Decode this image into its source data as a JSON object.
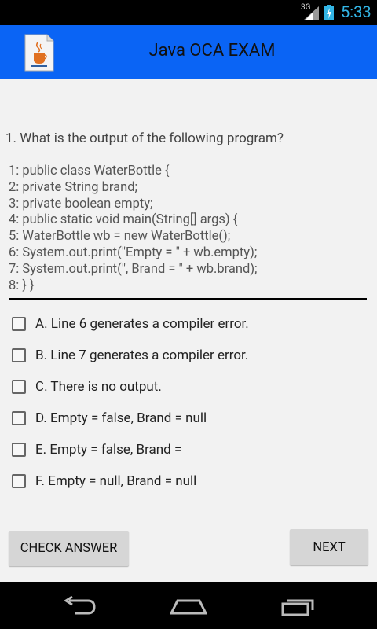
{
  "status_bar": {
    "network": "3G",
    "time": "5:33"
  },
  "app": {
    "title": "Java OCA EXAM"
  },
  "question": {
    "text": "1. What is the output of the following program?",
    "code_lines": [
      "1: public class WaterBottle {",
      "2: private String brand;",
      "3: private boolean empty;",
      "4: public static void main(String[] args) {",
      "5: WaterBottle wb = new WaterBottle();",
      "6: System.out.print(\"Empty = \" + wb.empty);",
      "7: System.out.print(\", Brand = \" + wb.brand);",
      "8: } }"
    ]
  },
  "options": [
    {
      "label": "A. Line 6 generates a compiler error.",
      "checked": false
    },
    {
      "label": "B. Line 7 generates a compiler error.",
      "checked": false
    },
    {
      "label": "C. There is no output.",
      "checked": false
    },
    {
      "label": "D. Empty = false, Brand = null",
      "checked": false
    },
    {
      "label": "E. Empty = false, Brand =",
      "checked": false
    },
    {
      "label": "F. Empty = null, Brand = null",
      "checked": false
    }
  ],
  "buttons": {
    "check_answer": "CHECK ANSWER",
    "next": "NEXT"
  },
  "colors": {
    "action_bar": "#0a64f5",
    "clock": "#33b5e5"
  },
  "icons": {
    "app": "java-cup-icon",
    "nav": [
      "back-icon",
      "home-icon",
      "recents-icon"
    ]
  }
}
